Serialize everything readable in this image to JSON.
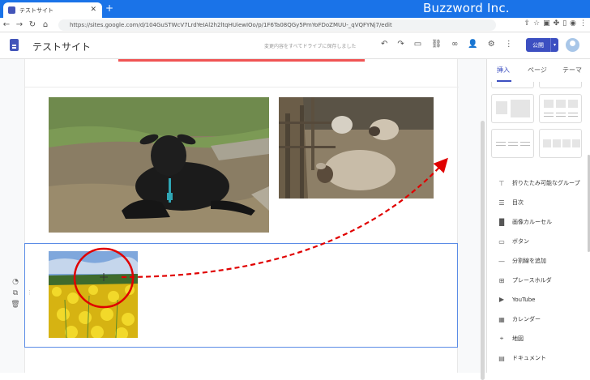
{
  "browser": {
    "tab_title": "テストサイト",
    "url": "https://sites.google.com/d/104GuSTWcV7LrdYeIAl2h2ltqHUiewIOo/p/1F6Ta08QGy5PmYoFDoZMUU-_qVQFYNj7/edit",
    "brand": "Buzzword Inc."
  },
  "header": {
    "site_title": "テストサイト",
    "save_status": "変更内容をすべてドライブに保存しました",
    "publish_label": "公開"
  },
  "panel": {
    "tabs": [
      {
        "label": "挿入"
      },
      {
        "label": "ページ"
      },
      {
        "label": "テーマ"
      }
    ],
    "items": [
      {
        "label": "折りたたみ可能なグループ",
        "icon": "collapse-icon"
      },
      {
        "label": "目次",
        "icon": "toc-icon"
      },
      {
        "label": "画像カルーセル",
        "icon": "carousel-icon"
      },
      {
        "label": "ボタン",
        "icon": "button-icon"
      },
      {
        "label": "分割線を追加",
        "icon": "divider-icon"
      },
      {
        "label": "プレースホルダ",
        "icon": "placeholder-icon"
      },
      {
        "label": "YouTube",
        "icon": "youtube-icon"
      },
      {
        "label": "カレンダー",
        "icon": "calendar-icon"
      },
      {
        "label": "地図",
        "icon": "map-icon"
      },
      {
        "label": "ドキュメント",
        "icon": "document-icon"
      }
    ]
  },
  "colors": {
    "accent": "#3c4fc1",
    "browser_bar": "#1a73e8",
    "selection": "#5b8ce6",
    "annotation": "#e00000"
  }
}
